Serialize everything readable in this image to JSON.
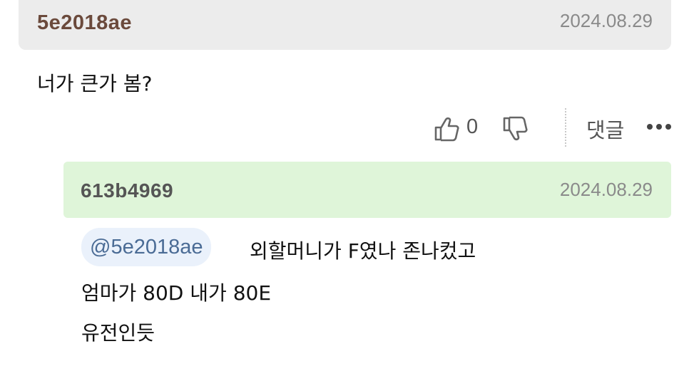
{
  "comment": {
    "author": "5e2018ae",
    "date": "2024.08.29",
    "body": "너가 큰가 봄?",
    "like_count": "0",
    "reply_label": "댓글"
  },
  "reply": {
    "author": "613b4969",
    "date": "2024.08.29",
    "mention": "@5e2018ae",
    "lines": [
      "외할머니가 F였나 존나컸고",
      "엄마가 80D 내가 80E",
      "유전인듯"
    ]
  },
  "icons": {
    "like": "thumbs-up-icon",
    "dislike": "thumbs-down-icon",
    "more": "more-dots-icon"
  },
  "colors": {
    "comment_header_bg": "#ececec",
    "reply_header_bg": "#dff5d9",
    "author_color": "#6b4a3c",
    "mention_bg": "#eaf1fb",
    "mention_text": "#4a6b95"
  }
}
